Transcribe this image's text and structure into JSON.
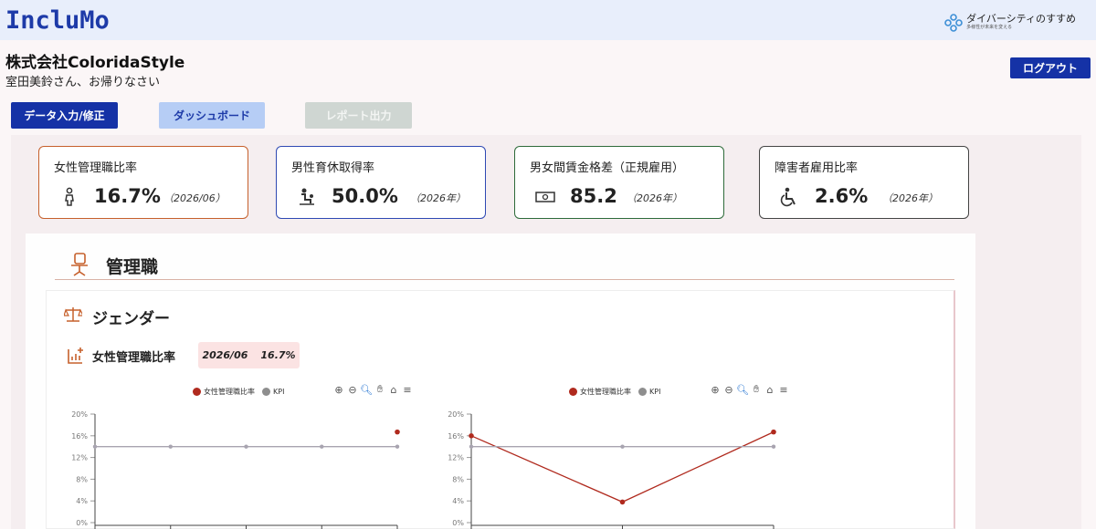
{
  "header": {
    "logo": "IncluMo",
    "diversity_title": "ダイバーシティのすすめ",
    "diversity_sub": "多様性が未来を変える"
  },
  "user": {
    "company": "株式会社ColoridaStyle",
    "greeting": "室田美鈴さん、お帰りなさい",
    "logout_label": "ログアウト"
  },
  "nav": {
    "data_entry": "データ入力/修正",
    "dashboard": "ダッシュボード",
    "report": "レポート出力"
  },
  "kpis": [
    {
      "title": "女性管理職比率",
      "value": "16.7%",
      "period": "（2026/06）",
      "icon": "woman-icon",
      "color": "#c6602c"
    },
    {
      "title": "男性育休取得率",
      "value": "50.0%",
      "period": "（2026年）",
      "icon": "childcare-icon",
      "color": "#2f49b3"
    },
    {
      "title": "男女間賃金格差（正規雇用）",
      "value": "85.2",
      "period": "（2026年）",
      "icon": "money-icon",
      "color": "#2e6b3a"
    },
    {
      "title": "障害者雇用比率",
      "value": "2.6%",
      "period": "（2026年）",
      "icon": "wheelchair-icon",
      "color": "#444444"
    }
  ],
  "section": {
    "title": "管理職",
    "subsection": "ジェンダー",
    "metric_title": "女性管理職比率",
    "metric_period": "2026/06",
    "metric_value": "16.7%"
  },
  "chart_data": [
    {
      "type": "line",
      "legend": [
        "女性管理職比率",
        "KPI"
      ],
      "y_ticks": [
        "20%",
        "16%",
        "12%",
        "8%",
        "4%",
        "0%"
      ],
      "ylim": [
        0,
        20
      ],
      "x_count": 5,
      "series": [
        {
          "name": "女性管理職比率",
          "color": "#b02a1e",
          "values": [
            null,
            null,
            null,
            null,
            16.7
          ]
        },
        {
          "name": "KPI",
          "color": "#a8a4b0",
          "values": [
            14,
            14,
            14,
            14,
            14
          ]
        }
      ]
    },
    {
      "type": "line",
      "legend": [
        "女性管理職比率",
        "KPI"
      ],
      "y_ticks": [
        "20%",
        "16%",
        "12%",
        "8%",
        "4%",
        "0%"
      ],
      "ylim": [
        0,
        20
      ],
      "x_count": 3,
      "series": [
        {
          "name": "女性管理職比率",
          "color": "#b02a1e",
          "values": [
            16,
            3.8,
            16.7
          ]
        },
        {
          "name": "KPI",
          "color": "#a8a4b0",
          "values": [
            14,
            14,
            14
          ]
        }
      ]
    }
  ]
}
